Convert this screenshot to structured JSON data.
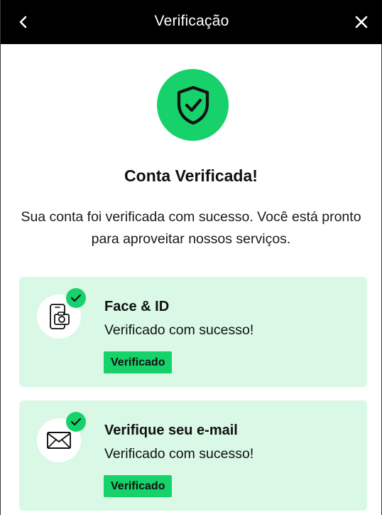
{
  "header": {
    "title": "Verificação",
    "back_icon": "chevron-left-icon",
    "close_icon": "close-icon"
  },
  "hero": {
    "icon": "shield-check-icon",
    "headline": "Conta Verificada!",
    "description": "Sua conta foi verificada com sucesso. Você está pronto para aproveitar nossos serviços."
  },
  "cards": [
    {
      "icon": "phone-camera-icon",
      "title": "Face & ID",
      "subtitle": "Verificado com sucesso!",
      "badge": "Verificado"
    },
    {
      "icon": "envelope-icon",
      "title": "Verifique seu e-mail",
      "subtitle": "Verificado com sucesso!",
      "badge": "Verificado"
    }
  ],
  "colors": {
    "header_bg": "#000000",
    "accent": "#17d16a",
    "card_bg": "#d9f8e6"
  }
}
